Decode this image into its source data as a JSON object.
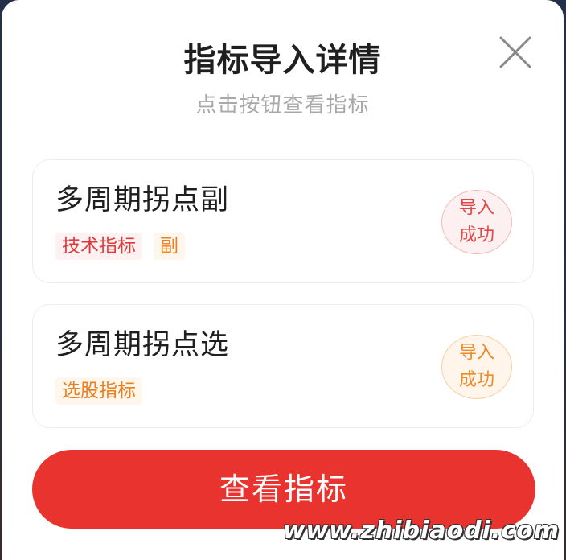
{
  "dialog": {
    "title": "指标导入详情",
    "subtitle": "点击按钮查看指标",
    "close_icon": "close-icon"
  },
  "items": [
    {
      "name": "多周期拐点副",
      "tags": [
        "技术指标",
        "副"
      ],
      "status_line1": "导入",
      "status_line2": "成功",
      "status_color": "#e04848"
    },
    {
      "name": "多周期拐点选",
      "tags": [
        "选股指标"
      ],
      "status_line1": "导入",
      "status_line2": "成功",
      "status_color": "#ee8a2a"
    }
  ],
  "actions": {
    "view_label": "查看指标",
    "accent_color": "#e8332f"
  },
  "watermark": "www.zhibiaodi.com"
}
